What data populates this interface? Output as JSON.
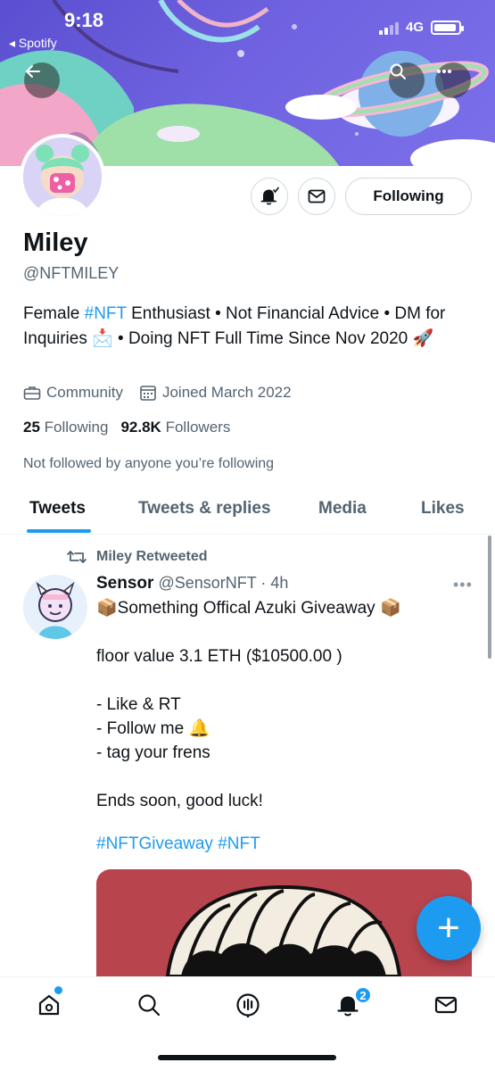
{
  "status_bar": {
    "time": "9:18",
    "back_app": "◂ Spotify",
    "network": "4G"
  },
  "profile": {
    "name": "Miley",
    "handle": "@NFTMILEY",
    "bio_parts": [
      "Female ",
      "#NFT",
      " Enthusiast • Not Financial Advice • DM for Inquiries 📩 • Doing NFT Full Time Since Nov 2020 🚀"
    ],
    "category": "Community",
    "joined": "Joined March 2022",
    "following_count": "25",
    "following_label": "Following",
    "followers_count": "92.8K",
    "followers_label": "Followers",
    "not_followed": "Not followed by anyone you’re following",
    "follow_button": "Following"
  },
  "tabs": [
    "Tweets",
    "Tweets & replies",
    "Media",
    "Likes"
  ],
  "tweet": {
    "retweeted_by": "Miley Retweeted",
    "author_name": "Sensor",
    "author_handle": "@SensorNFT",
    "time": "· 4h",
    "more": "•••",
    "body": "📦Something Offical Azuki Giveaway 📦\n\nfloor value 3.1 ETH ($10500.00 )\n\n- Like & RT\n- Follow me 🔔\n- tag your frens\n\nEnds soon, good luck!",
    "hashtags": "#NFTGiveaway #NFT"
  },
  "fab": "+",
  "bottom_nav": {
    "notifications_badge": "2"
  },
  "colors": {
    "accent": "#1d9bf0",
    "banner": "#6f62e0",
    "media_bg": "#b8444e"
  }
}
